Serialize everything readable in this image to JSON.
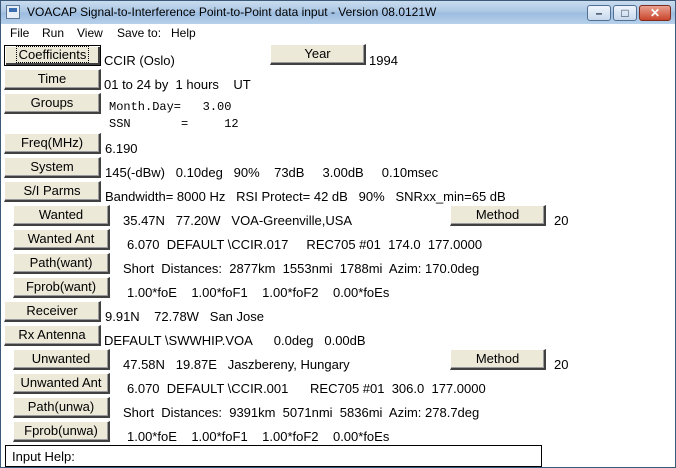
{
  "window": {
    "title": "VOACAP Signal-to-Interference Point-to-Point data input - Version 08.0121W"
  },
  "menu": [
    "File",
    "Run",
    "View",
    "Save to:",
    "Help"
  ],
  "buttons": {
    "coefficients": "Coefficients",
    "time": "Time",
    "groups": "Groups",
    "year": "Year",
    "freq": "Freq(MHz)",
    "system": "System",
    "si_parms": "S/I Parms",
    "wanted": "Wanted",
    "wanted_ant": "Wanted Ant",
    "path_want": "Path(want)",
    "fprob_want": "Fprob(want)",
    "receiver": "Receiver",
    "rx_antenna": "Rx Antenna",
    "unwanted": "Unwanted",
    "unwanted_ant": "Unwanted Ant",
    "path_unwa": "Path(unwa)",
    "fprob_unwa": "Fprob(unwa)",
    "method1": "Method",
    "method2": "Method"
  },
  "values": {
    "coefficients": "CCIR (Oslo)",
    "year": "1994",
    "time": "01 to 24 by  1 hours    UT",
    "groups_line1": "Month.Day=   3.00",
    "groups_line2": "SSN       =     12",
    "freq": "6.190",
    "system": "145(-dBw)   0.10deg   90%    73dB     3.00dB     0.10msec",
    "si_parms": "Bandwidth= 8000 Hz   RSI Protect= 42 dB   90%   SNRxx_min=65 dB",
    "wanted": "35.47N   77.20W   VOA-Greenville,USA",
    "method1": "20",
    "wanted_ant": "6.070  DEFAULT \\CCIR.017     REC705 #01  174.0  177.0000",
    "path_want": "Short  Distances:  2877km  1553nmi  1788mi  Azim: 170.0deg",
    "fprob_want": "1.00*foE    1.00*foF1    1.00*foF2    0.00*foEs",
    "receiver": "9.91N    72.78W   San Jose",
    "rx_antenna": "DEFAULT \\SWWHIP.VOA      0.0deg   0.00dB",
    "unwanted": "47.58N   19.87E   Jaszbereny, Hungary",
    "method2": "20",
    "unwanted_ant": "6.070  DEFAULT \\CCIR.001      REC705 #01  306.0  177.0000",
    "path_unwa": "Short  Distances:  9391km  5071nmi  5836mi  Azim: 278.7deg",
    "fprob_unwa": "1.00*foE    1.00*foF1    1.00*foF2    0.00*foEs"
  },
  "input_help": {
    "label": "Input Help:"
  }
}
